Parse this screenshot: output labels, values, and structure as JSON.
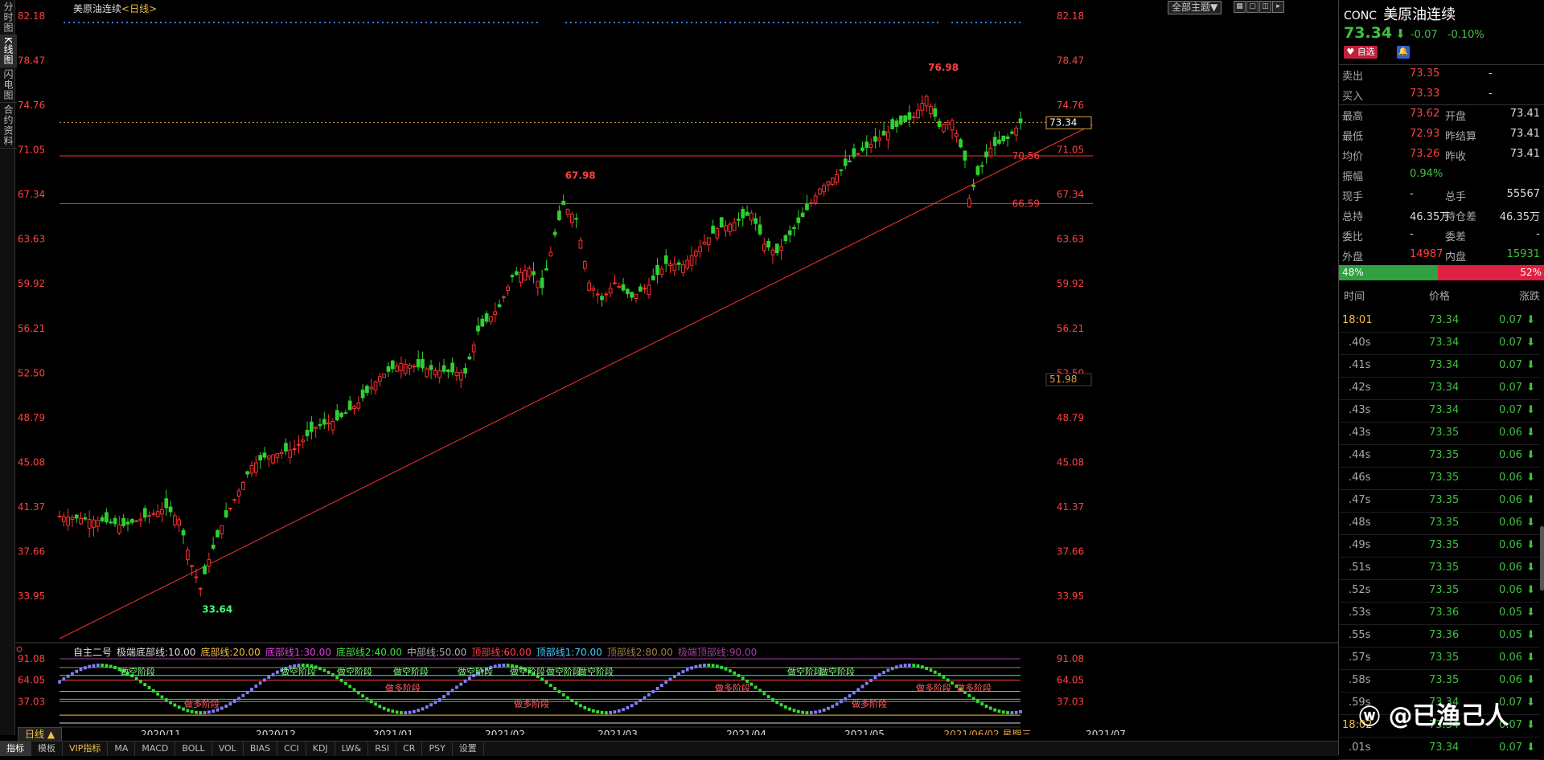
{
  "left_tabs": [
    {
      "label": "分时图"
    },
    {
      "label": "K线图"
    },
    {
      "label": "闪电图"
    },
    {
      "label": "合约资料"
    }
  ],
  "title": {
    "name": "美原油连续",
    "period": "<日线>"
  },
  "toolbar": {
    "theme_label": "全部主题▼"
  },
  "price_axis": [
    "82.18",
    "78.47",
    "74.76",
    "71.05",
    "67.34",
    "63.63",
    "59.92",
    "56.21",
    "52.50",
    "48.79",
    "45.08",
    "41.37",
    "37.66",
    "33.95"
  ],
  "price_markers": {
    "last": "73.34",
    "bottom": "51.98"
  },
  "hlines": [
    {
      "label": "70.56",
      "color": "#ff3030"
    },
    {
      "label": "66.59",
      "color": "#ff3030"
    }
  ],
  "annotations": [
    {
      "label": "76.98",
      "color": "#ff4040"
    },
    {
      "label": "67.98",
      "color": "#ff4040"
    },
    {
      "label": "33.64",
      "color": "#40ff80"
    }
  ],
  "x_axis": [
    "2020/11",
    "2020/12",
    "2021/01",
    "2021/02",
    "2021/03",
    "2021/04",
    "2021/05",
    "2021/06/02 星期三",
    "2021/07"
  ],
  "indicator": {
    "name": "自主二号",
    "params": [
      {
        "text": "极端底部线:10.00",
        "color": "#dddddd"
      },
      {
        "text": "底部线:20.00",
        "color": "#f0c040"
      },
      {
        "text": "底部线1:30.00",
        "color": "#e040e0"
      },
      {
        "text": "底部线2:40.00",
        "color": "#40e040"
      },
      {
        "text": "中部线:50.00",
        "color": "#aaaaaa"
      },
      {
        "text": "顶部线:60.00",
        "color": "#ff4040"
      },
      {
        "text": "顶部线1:70.00",
        "color": "#40d0ff"
      },
      {
        "text": "顶部线2:80.00",
        "color": "#a08040"
      },
      {
        "text": "极端顶部线:90.00",
        "color": "#a040a0"
      }
    ],
    "axis": [
      "91.08",
      "64.05",
      "37.03"
    ],
    "labels": [
      "做空阶段",
      "做空阶段",
      "做空阶段",
      "做空阶段",
      "做空阶段",
      "做空阶段",
      "做空阶段",
      "做空阶段",
      "做空阶段",
      "做空阶段",
      "做多阶段",
      "做多阶段",
      "做多阶段",
      "做多阶段",
      "做多阶段",
      "做多阶段",
      "做多阶段"
    ]
  },
  "period_tab": "日线 ▲",
  "bottom_tabs": [
    "指标",
    "模板",
    "VIP指标",
    "MA",
    "MACD",
    "BOLL",
    "VOL",
    "BIAS",
    "CCI",
    "KDJ",
    "LW&",
    "RSI",
    "CR",
    "PSY",
    "设置"
  ],
  "quote": {
    "code": "CONC",
    "name": "美原油连续",
    "price": "73.34",
    "arrow": "⬇",
    "change": "-0.07",
    "pct": "-0.10%",
    "fav_label": "自选",
    "sell": {
      "label": "卖出",
      "value": "73.35",
      "extra": "-"
    },
    "buy": {
      "label": "买入",
      "value": "73.33",
      "extra": "-"
    },
    "rows": [
      [
        {
          "l": "最高",
          "v": "73.62",
          "c": "red"
        },
        {
          "l": "开盘",
          "v": "73.41",
          "c": "wht"
        }
      ],
      [
        {
          "l": "最低",
          "v": "72.93",
          "c": "red"
        },
        {
          "l": "昨结算",
          "v": "73.41",
          "c": "wht"
        }
      ],
      [
        {
          "l": "均价",
          "v": "73.26",
          "c": "red"
        },
        {
          "l": "昨收",
          "v": "73.41",
          "c": "wht"
        }
      ],
      [
        {
          "l": "振幅",
          "v": "0.94%",
          "c": "grn"
        },
        {
          "l": "",
          "v": "",
          "c": "wht"
        }
      ],
      [
        {
          "l": "现手",
          "v": "-",
          "c": "wht"
        },
        {
          "l": "总手",
          "v": "55567",
          "c": "wht"
        }
      ],
      [
        {
          "l": "总持",
          "v": "46.35万",
          "c": "wht"
        },
        {
          "l": "持仓差",
          "v": "46.35万",
          "c": "wht"
        }
      ],
      [
        {
          "l": "委比",
          "v": "-",
          "c": "wht"
        },
        {
          "l": "委差",
          "v": "-",
          "c": "wht"
        }
      ],
      [
        {
          "l": "外盘",
          "v": "14987",
          "c": "red"
        },
        {
          "l": "内盘",
          "v": "15931",
          "c": "grn"
        }
      ]
    ],
    "ratio": {
      "buy": "48%",
      "sell": "52%",
      "buy_pct": 48
    },
    "tick_headers": [
      "时间",
      "价格",
      "涨跌"
    ],
    "ticks": [
      {
        "t": "18:01",
        "p": "73.34",
        "d": "0.07",
        "hl": true
      },
      {
        "t": ".40s",
        "p": "73.34",
        "d": "0.07"
      },
      {
        "t": ".41s",
        "p": "73.34",
        "d": "0.07"
      },
      {
        "t": ".42s",
        "p": "73.34",
        "d": "0.07"
      },
      {
        "t": ".43s",
        "p": "73.34",
        "d": "0.07"
      },
      {
        "t": ".43s",
        "p": "73.35",
        "d": "0.06"
      },
      {
        "t": ".44s",
        "p": "73.35",
        "d": "0.06"
      },
      {
        "t": ".46s",
        "p": "73.35",
        "d": "0.06"
      },
      {
        "t": ".47s",
        "p": "73.35",
        "d": "0.06"
      },
      {
        "t": ".48s",
        "p": "73.35",
        "d": "0.06"
      },
      {
        "t": ".49s",
        "p": "73.35",
        "d": "0.06"
      },
      {
        "t": ".51s",
        "p": "73.35",
        "d": "0.06"
      },
      {
        "t": ".52s",
        "p": "73.35",
        "d": "0.06"
      },
      {
        "t": ".53s",
        "p": "73.36",
        "d": "0.05"
      },
      {
        "t": ".55s",
        "p": "73.36",
        "d": "0.05"
      },
      {
        "t": ".57s",
        "p": "73.35",
        "d": "0.06"
      },
      {
        "t": ".58s",
        "p": "73.35",
        "d": "0.06"
      },
      {
        "t": ".59s",
        "p": "73.34",
        "d": "0.07"
      },
      {
        "t": "18:02",
        "p": "73.34",
        "d": "0.07",
        "hl": true
      },
      {
        "t": ".01s",
        "p": "73.34",
        "d": "0.07"
      }
    ]
  },
  "watermark": "@已渔己人"
}
